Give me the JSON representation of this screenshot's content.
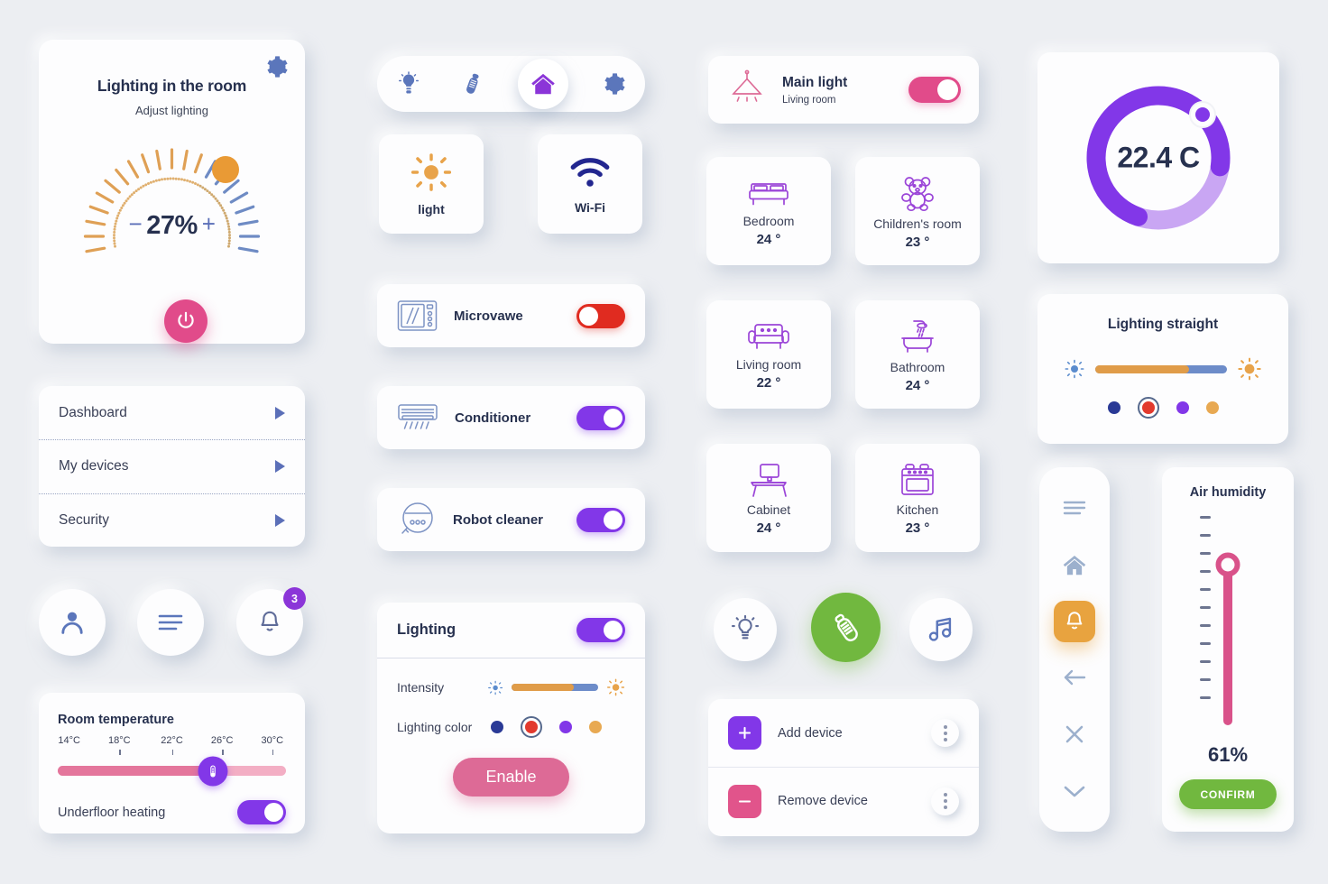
{
  "palette": {
    "bg": "#eceef2",
    "card": "#fdfdfe",
    "ink": "#27314f",
    "ink_soft": "#3a4057",
    "blue": "#5b6fb8",
    "steel": "#8fa8cc",
    "purple": "#8237e8",
    "pink": "#e14b8a",
    "orange": "#e09c49",
    "red": "#e02b20",
    "green": "#71b83f",
    "navy": "#22268f"
  },
  "lighting_room": {
    "title": "Lighting in the room",
    "subtitle": "Adjust lighting",
    "value": "27%",
    "minus": "−",
    "plus": "+",
    "gear_icon": "gear-icon",
    "power_icon": "power-icon",
    "dial_percent": 27,
    "dial_ticks": 21
  },
  "menu": {
    "items": [
      {
        "label": "Dashboard",
        "chevron": "triangle-right-icon"
      },
      {
        "label": "My devices",
        "chevron": "triangle-right-icon"
      },
      {
        "label": "Security",
        "chevron": "triangle-right-icon"
      }
    ]
  },
  "quick_circles": [
    {
      "name": "avatar-icon",
      "label": ""
    },
    {
      "name": "hamburger-icon",
      "label": ""
    },
    {
      "name": "bell-icon",
      "label": "",
      "badge": "3"
    }
  ],
  "room_temperature": {
    "title": "Room temperature",
    "ticks": [
      "14°C",
      "18°C",
      "22°C",
      "26°C",
      "30°C"
    ],
    "value_index": 3,
    "fill_percent": 68,
    "knob_icon": "thermometer-icon",
    "underfloor_label": "Underfloor heating",
    "underfloor_on": true
  },
  "nav_pill": {
    "items": [
      {
        "icon": "bulb-icon",
        "active": false
      },
      {
        "icon": "bottle-icon",
        "active": false
      },
      {
        "icon": "home-icon",
        "active": true
      },
      {
        "icon": "gear-icon",
        "active": false
      }
    ]
  },
  "tiles": [
    {
      "label": "light",
      "icon": "sun-icon"
    },
    {
      "label": "Wi-Fi",
      "icon": "wifi-icon"
    }
  ],
  "devices": [
    {
      "label": "Microvawe",
      "icon": "microwave-icon",
      "state": "off",
      "color": "red"
    },
    {
      "label": "Conditioner",
      "icon": "air-conditioner-icon",
      "state": "on",
      "color": "purple"
    },
    {
      "label": "Robot cleaner",
      "icon": "robot-vacuum-icon",
      "state": "on",
      "color": "purple"
    }
  ],
  "lighting_panel": {
    "title": "Lighting",
    "toggle_on": true,
    "intensity_label": "Intensity",
    "intensity_percent": 72,
    "intensity_icon_left": "sun-small-icon",
    "intensity_icon_right": "sun-big-icon",
    "color_label": "Lighting color",
    "colors": [
      "#2a3a96",
      "#e23a2e",
      "#8237e8",
      "#e8a952"
    ],
    "selected_color_index": 1,
    "button_label": "Enable"
  },
  "main_light": {
    "title": "Main light",
    "subtitle": "Living room",
    "icon": "pendant-lamp-icon",
    "toggle_on": true
  },
  "rooms": [
    {
      "name": "Bedroom",
      "temp": "24 °",
      "icon": "bed-icon"
    },
    {
      "name": "Children's room",
      "temp": "23 °",
      "icon": "teddy-bear-icon"
    },
    {
      "name": "Living room",
      "temp": "22 °",
      "icon": "sofa-icon"
    },
    {
      "name": "Bathroom",
      "temp": "24 °",
      "icon": "bathtub-icon"
    },
    {
      "name": "Cabinet",
      "temp": "24 °",
      "icon": "desk-icon"
    },
    {
      "name": "Kitchen",
      "temp": "23 °",
      "icon": "oven-icon"
    }
  ],
  "mode_circles": [
    {
      "icon": "bulb-icon",
      "active": false
    },
    {
      "icon": "bottle-icon",
      "active": true
    },
    {
      "icon": "music-note-icon",
      "active": false
    }
  ],
  "device_actions": [
    {
      "label": "Add device",
      "icon": "plus-icon",
      "color": "#8237e8",
      "menu": "kebab-icon"
    },
    {
      "label": "Remove device",
      "icon": "minus-icon",
      "color": "#e1548b",
      "menu": "kebab-icon"
    }
  ],
  "temp_gauge": {
    "value": "22.4 C",
    "fill_percent": 72,
    "handle_icon": "gauge-handle-icon"
  },
  "lighting_straight": {
    "title": "Lighting straight",
    "slider_percent": 71,
    "icon_left": "sun-small-icon",
    "icon_right": "sun-big-icon",
    "colors": [
      "#2a3a96",
      "#e23a2e",
      "#8237e8",
      "#e8a952"
    ],
    "selected_color_index": 1
  },
  "vertical_sidebar": {
    "items": [
      {
        "icon": "hamburger-icon",
        "active": false
      },
      {
        "icon": "home-icon",
        "active": false
      },
      {
        "icon": "bell-icon",
        "active": true
      },
      {
        "icon": "arrow-left-icon",
        "active": false
      },
      {
        "icon": "close-icon",
        "active": false
      },
      {
        "icon": "chevron-down-icon",
        "active": false
      }
    ]
  },
  "air_humidity": {
    "title": "Air humidity",
    "value": "61%",
    "level_percent": 61,
    "ticks": 11,
    "button_label": "CONFIRM"
  }
}
